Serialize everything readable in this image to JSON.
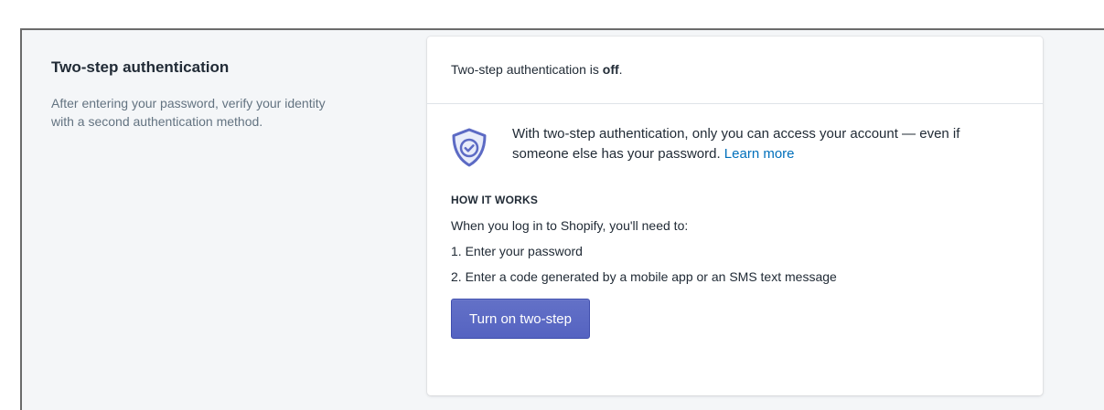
{
  "section": {
    "title": "Two-step authentication",
    "description": "After entering your password, verify your identity with a second authentication method."
  },
  "card": {
    "status_prefix": "Two-step authentication is ",
    "status_value": "off",
    "status_suffix": ".",
    "shield_icon": "shield-check-icon",
    "intro_text": "With two-step authentication, only you can access your account — even if someone else has your password. ",
    "learn_more": "Learn more",
    "how_it_works_title": "HOW IT WORKS",
    "how_it_works_intro": "When you log in to Shopify, you'll need to:",
    "steps": [
      "1. Enter your password",
      "2. Enter a code generated by a mobile app or an SMS text message"
    ],
    "button_label": "Turn on two-step"
  },
  "colors": {
    "accent": "#5c6ac4",
    "link": "#006fbb",
    "background": "#f4f6f8"
  }
}
